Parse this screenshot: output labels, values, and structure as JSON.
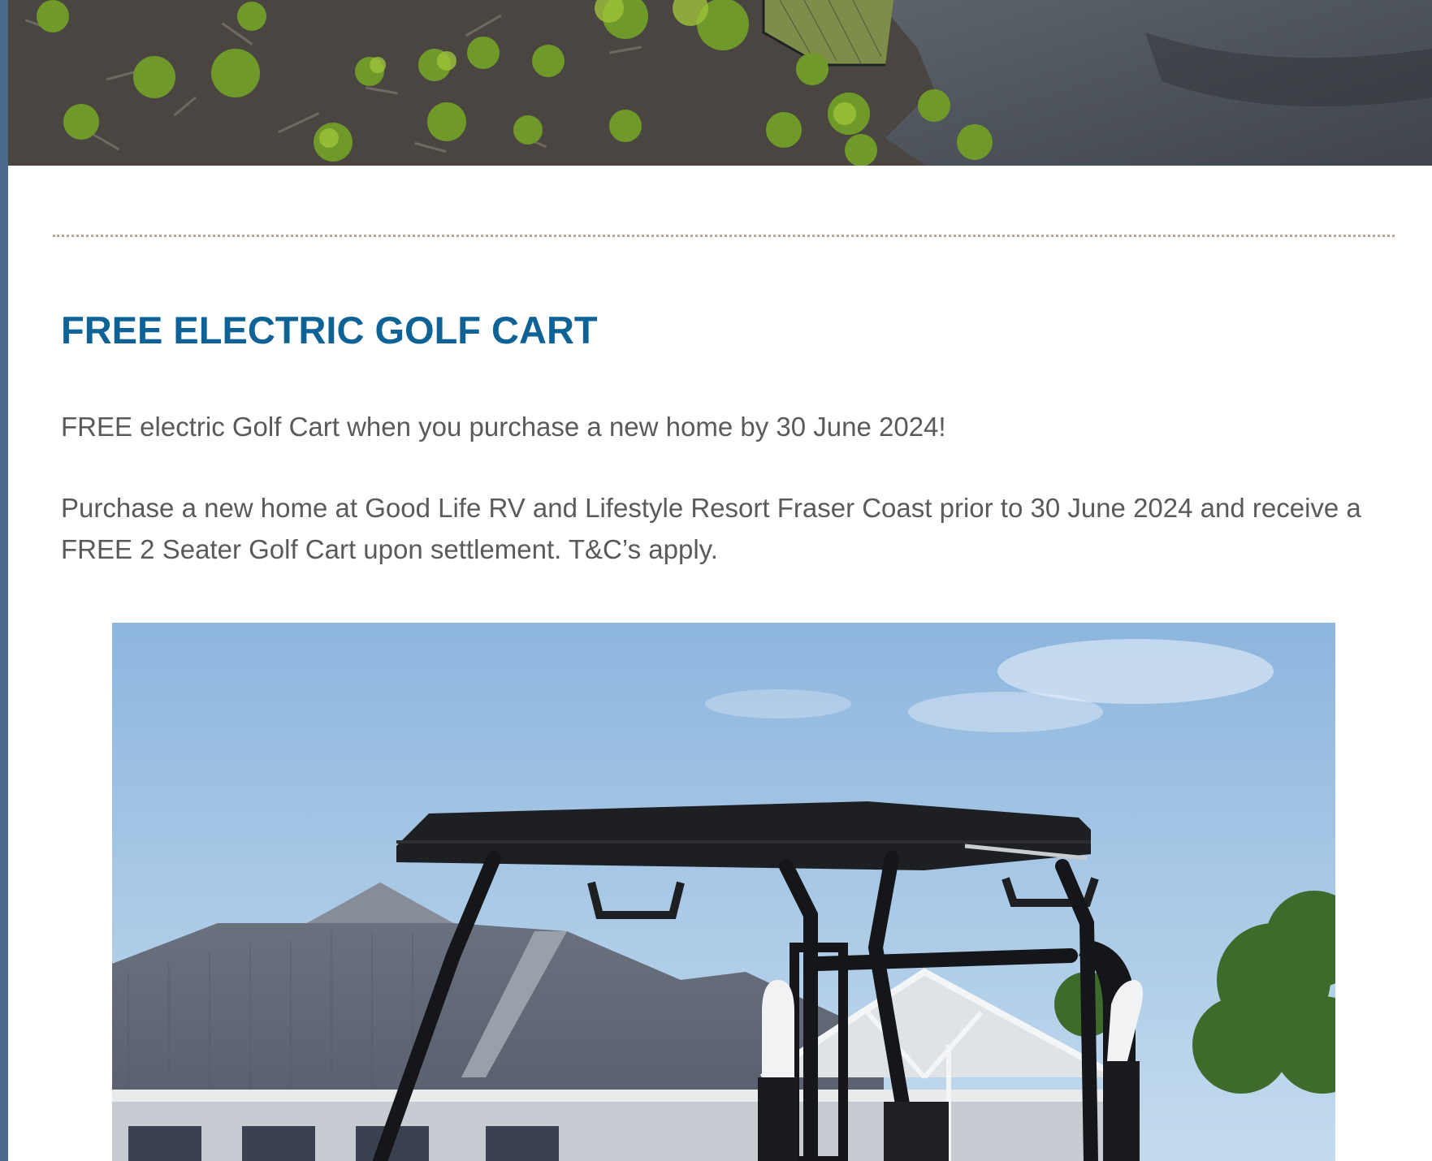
{
  "promo": {
    "title": "FREE ELECTRIC GOLF CART",
    "intro": "FREE electric Golf Cart when you purchase a new home by 30 June 2024!",
    "details": "Purchase a new home at Good Life RV and Lifestyle Resort Fraser Coast prior to 30 June 2024 and receive a FREE 2 Seater Golf Cart upon settlement. T&C’s apply."
  },
  "colors": {
    "heading": "#0f6296",
    "body_text": "#5a5a5a",
    "divider": "#b9a89a",
    "left_rail": "#4a6a8c"
  }
}
